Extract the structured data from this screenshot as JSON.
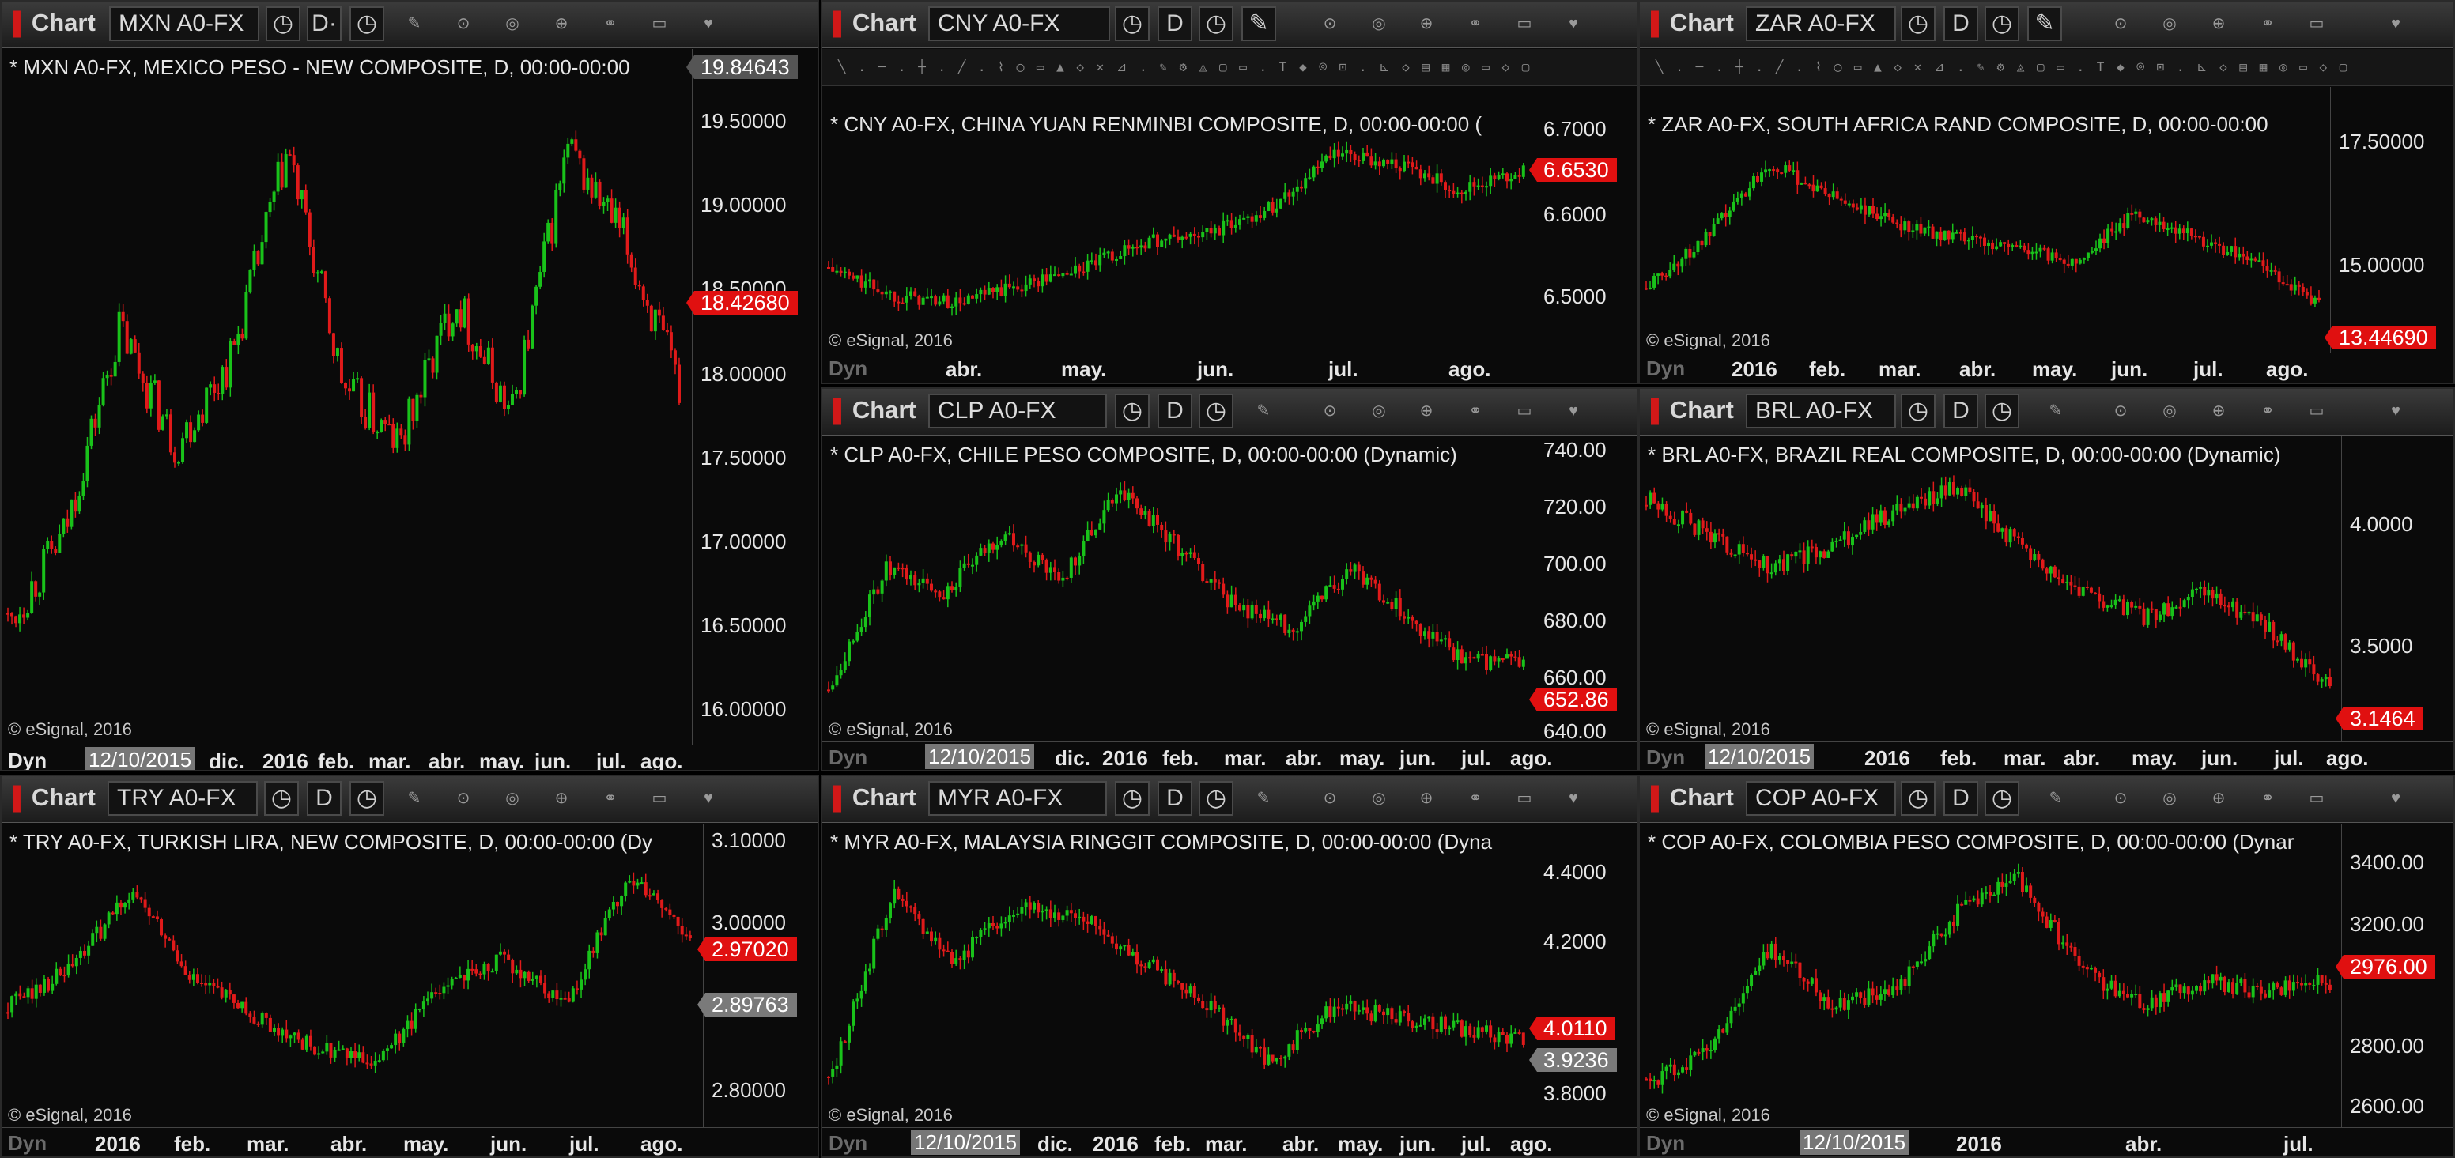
{
  "app": {
    "chart_label": "Chart",
    "copyright": "© eSignal, 2016",
    "dyn_label": "Dyn",
    "date_btn": "D",
    "date_btn_dot": "D·",
    "symbol_dot": "MXN A0-FX ·"
  },
  "colors": {
    "up": "#19c21a",
    "down": "#e01a1a",
    "background": "#0a0a0a",
    "price_tag": "#e01010"
  },
  "icons": [
    "clock-icon",
    "pencil-icon",
    "target-icon",
    "link-icon",
    "window-icon",
    "twitter-icon"
  ],
  "panels": [
    {
      "id": "mxn",
      "symbol": "MXN A0-FX ·",
      "title": "* MXN A0-FX, MEXICO PESO - NEW COMPOSITE, D, 00:00-00:00",
      "top_price": "19.84643",
      "price_ticks": [
        "19.50000",
        "19.00000",
        "18.50000",
        "18.00000",
        "17.50000",
        "17.00000",
        "16.50000",
        "16.00000"
      ],
      "last_price": "18.42680",
      "x_selected": "12/10/2015",
      "x_ticks": [
        "dic.",
        "2016",
        "feb.",
        "mar.",
        "abr.",
        "may.",
        "jun.",
        "jul.",
        "ago."
      ]
    },
    {
      "id": "cny",
      "symbol": "CNY A0-FX",
      "title": "* CNY A0-FX, CHINA YUAN RENMINBI COMPOSITE, D, 00:00-00:00 (",
      "price_ticks": [
        "6.7000",
        "6.6000",
        "6.5000"
      ],
      "last_price": "6.6530",
      "x_ticks": [
        "abr.",
        "may.",
        "jun.",
        "jul.",
        "ago."
      ]
    },
    {
      "id": "zar",
      "symbol": "ZAR A0-FX",
      "title": "* ZAR A0-FX, SOUTH AFRICA RAND COMPOSITE, D, 00:00-00:00",
      "price_ticks": [
        "17.50000",
        "15.00000"
      ],
      "last_price": "13.44690",
      "x_ticks": [
        "2016",
        "feb.",
        "mar.",
        "abr.",
        "may.",
        "jun.",
        "jul.",
        "ago."
      ]
    },
    {
      "id": "clp",
      "symbol": "CLP A0-FX",
      "title": "* CLP A0-FX, CHILE PESO COMPOSITE, D, 00:00-00:00 (Dynamic)",
      "price_ticks": [
        "740.00",
        "720.00",
        "700.00",
        "680.00",
        "660.00",
        "640.00"
      ],
      "last_price": "652.86",
      "x_selected": "12/10/2015",
      "x_ticks": [
        "dic.",
        "2016",
        "feb.",
        "mar.",
        "abr.",
        "may.",
        "jun.",
        "jul.",
        "ago."
      ]
    },
    {
      "id": "brl",
      "symbol": "BRL A0-FX",
      "title": "* BRL A0-FX, BRAZIL REAL COMPOSITE, D, 00:00-00:00 (Dynamic)",
      "price_ticks": [
        "4.0000",
        "3.5000"
      ],
      "last_price": "3.1464",
      "x_selected": "12/10/2015",
      "x_ticks": [
        "2016",
        "feb.",
        "mar.",
        "abr.",
        "may.",
        "jun.",
        "jul.",
        "ago."
      ]
    },
    {
      "id": "try",
      "symbol": "TRY A0-FX",
      "title": "* TRY A0-FX, TURKISH LIRA, NEW COMPOSITE, D, 00:00-00:00 (Dy",
      "price_ticks": [
        "3.10000",
        "3.00000",
        "2.80000"
      ],
      "last_price": "2.97020",
      "cursor_price": "2.89763",
      "x_ticks": [
        "2016",
        "feb.",
        "mar.",
        "abr.",
        "may.",
        "jun.",
        "jul.",
        "ago."
      ]
    },
    {
      "id": "myr",
      "symbol": "MYR A0-FX",
      "title": "* MYR A0-FX, MALAYSIA RINGGIT COMPOSITE, D, 00:00-00:00 (Dyna",
      "price_ticks": [
        "4.4000",
        "4.2000",
        "3.8000"
      ],
      "last_price": "4.0110",
      "cursor_price": "3.9236",
      "x_selected": "12/10/2015",
      "x_ticks": [
        "dic.",
        "2016",
        "feb.",
        "mar.",
        "abr.",
        "may.",
        "jun.",
        "jul.",
        "ago."
      ]
    },
    {
      "id": "cop",
      "symbol": "COP A0-FX",
      "title": "* COP A0-FX, COLOMBIA PESO COMPOSITE, D, 00:00-00:00 (Dynar",
      "price_ticks": [
        "3400.00",
        "3200.00",
        "2800.00",
        "2600.00"
      ],
      "last_price": "2976.00",
      "x_selected": "12/10/2015",
      "x_ticks": [
        "2016",
        "abr.",
        "jul."
      ]
    }
  ]
}
